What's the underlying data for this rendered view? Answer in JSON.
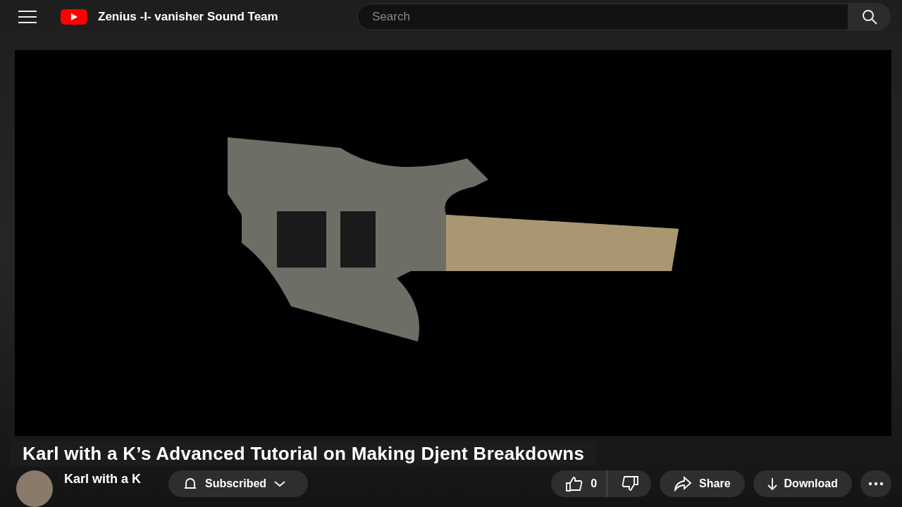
{
  "header": {
    "channel_title": "Zenius -I- vanisher Sound Team",
    "search": {
      "placeholder": "Search"
    }
  },
  "video": {
    "title": "Karl with a K’s Advanced Tutorial on Making Djent Breakdowns"
  },
  "channel": {
    "name": "Karl with a K",
    "subscribe_label": "Subscribed"
  },
  "actions": {
    "like_count": "0",
    "share_label": "Share",
    "download_label": "Download"
  }
}
